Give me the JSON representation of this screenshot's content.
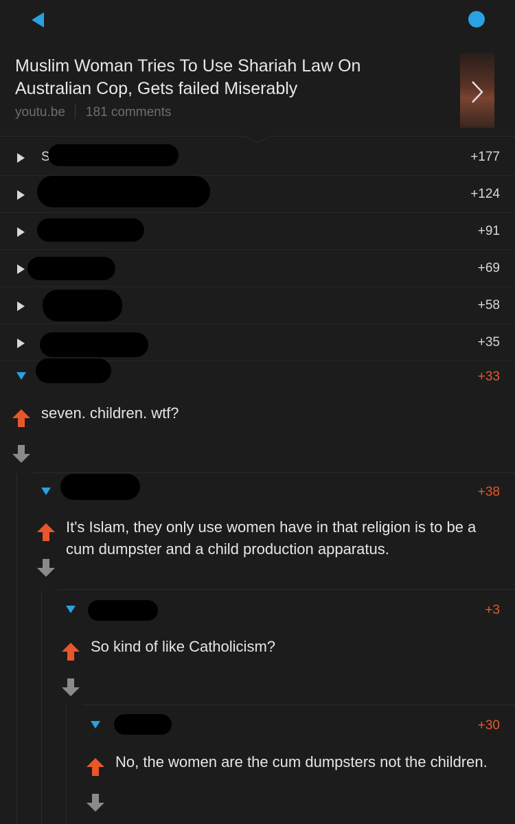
{
  "post": {
    "title": "Muslim Woman Tries To Use Shariah Law On Australian Cop, Gets failed Miserably",
    "domain": "youtu.be",
    "comments": "181 comments"
  },
  "collapsed_comments": [
    {
      "author_visible": "S",
      "score": "+177"
    },
    {
      "author_visible": "",
      "score": "+124"
    },
    {
      "author_visible": "",
      "score": "+91"
    },
    {
      "author_visible": "",
      "score": "+69"
    },
    {
      "author_visible": "",
      "score": "+58"
    },
    {
      "author_visible": "",
      "score": "+35"
    }
  ],
  "thread": [
    {
      "score": "+33",
      "body": "seven. children. wtf?"
    },
    {
      "score": "+38",
      "body": "It's Islam, they only use women have in that religion is to be a cum dumpster and a child production apparatus."
    },
    {
      "score": "+3",
      "body": "So kind of like Catholicism?"
    },
    {
      "score": "+30",
      "body": "No, the women are the cum dumpsters not the children."
    }
  ],
  "colors": {
    "background": "#1c1c1c",
    "accent_blue": "#2aa1e2",
    "upvote_orange": "#e8572b",
    "downvote_gray": "#8a8a8a"
  },
  "icons": [
    "back-arrow-icon",
    "menu-dot-icon",
    "chevron-right-icon",
    "collapse-triangle-icon",
    "expand-triangle-icon",
    "upvote-arrow-icon",
    "downvote-arrow-icon"
  ]
}
